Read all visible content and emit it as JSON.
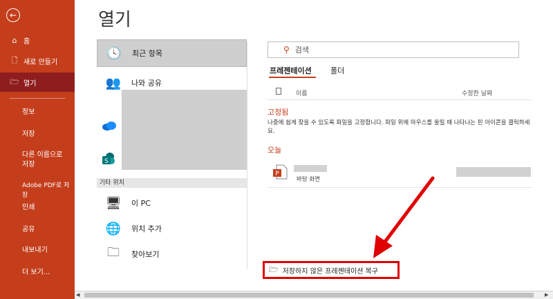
{
  "sidebar": {
    "back_icon": "arrow-left-icon",
    "items": [
      {
        "label": "홈",
        "icon": "home-icon"
      },
      {
        "label": "새로 만들기",
        "icon": "new-document-icon"
      },
      {
        "label": "열기",
        "icon": "folder-open-icon"
      }
    ],
    "sub_items": [
      "정보",
      "저장",
      "다른 이름으로\n저장",
      "Adobe PDF로 저장",
      "인쇄",
      "공유",
      "내보내기",
      "더 보기..."
    ]
  },
  "main": {
    "title": "열기",
    "locations": [
      {
        "label": "최근 항목",
        "icon": "clock-icon"
      },
      {
        "label": "나와 공유",
        "icon": "shared-people-icon"
      }
    ],
    "other_locations_header": "기타 위치",
    "other_locations": [
      {
        "label": "이 PC",
        "icon": "pc-icon"
      },
      {
        "label": "위치 추가",
        "icon": "add-location-icon"
      },
      {
        "label": "찾아보기",
        "icon": "folder-icon"
      }
    ]
  },
  "files": {
    "search_placeholder": "검색",
    "tabs": [
      "프레젠테이션",
      "폴더"
    ],
    "columns": {
      "name": "이름",
      "modified": "수정한 날짜"
    },
    "pinned_heading": "고정됨",
    "pinned_description": "나중에 쉽게 찾을 수 있도록 파일을 고정합니다. 파일 위에 마우스를 올릴 때 나타나는 핀 아이콘을 클릭하세요.",
    "today_heading": "오늘",
    "recent_file_location": "바탕 화면",
    "recover_label": "저장하지 않은 프레젠테이션 복구"
  },
  "colors": {
    "accent": "#c43e1c",
    "annotation_red": "#e00000"
  }
}
